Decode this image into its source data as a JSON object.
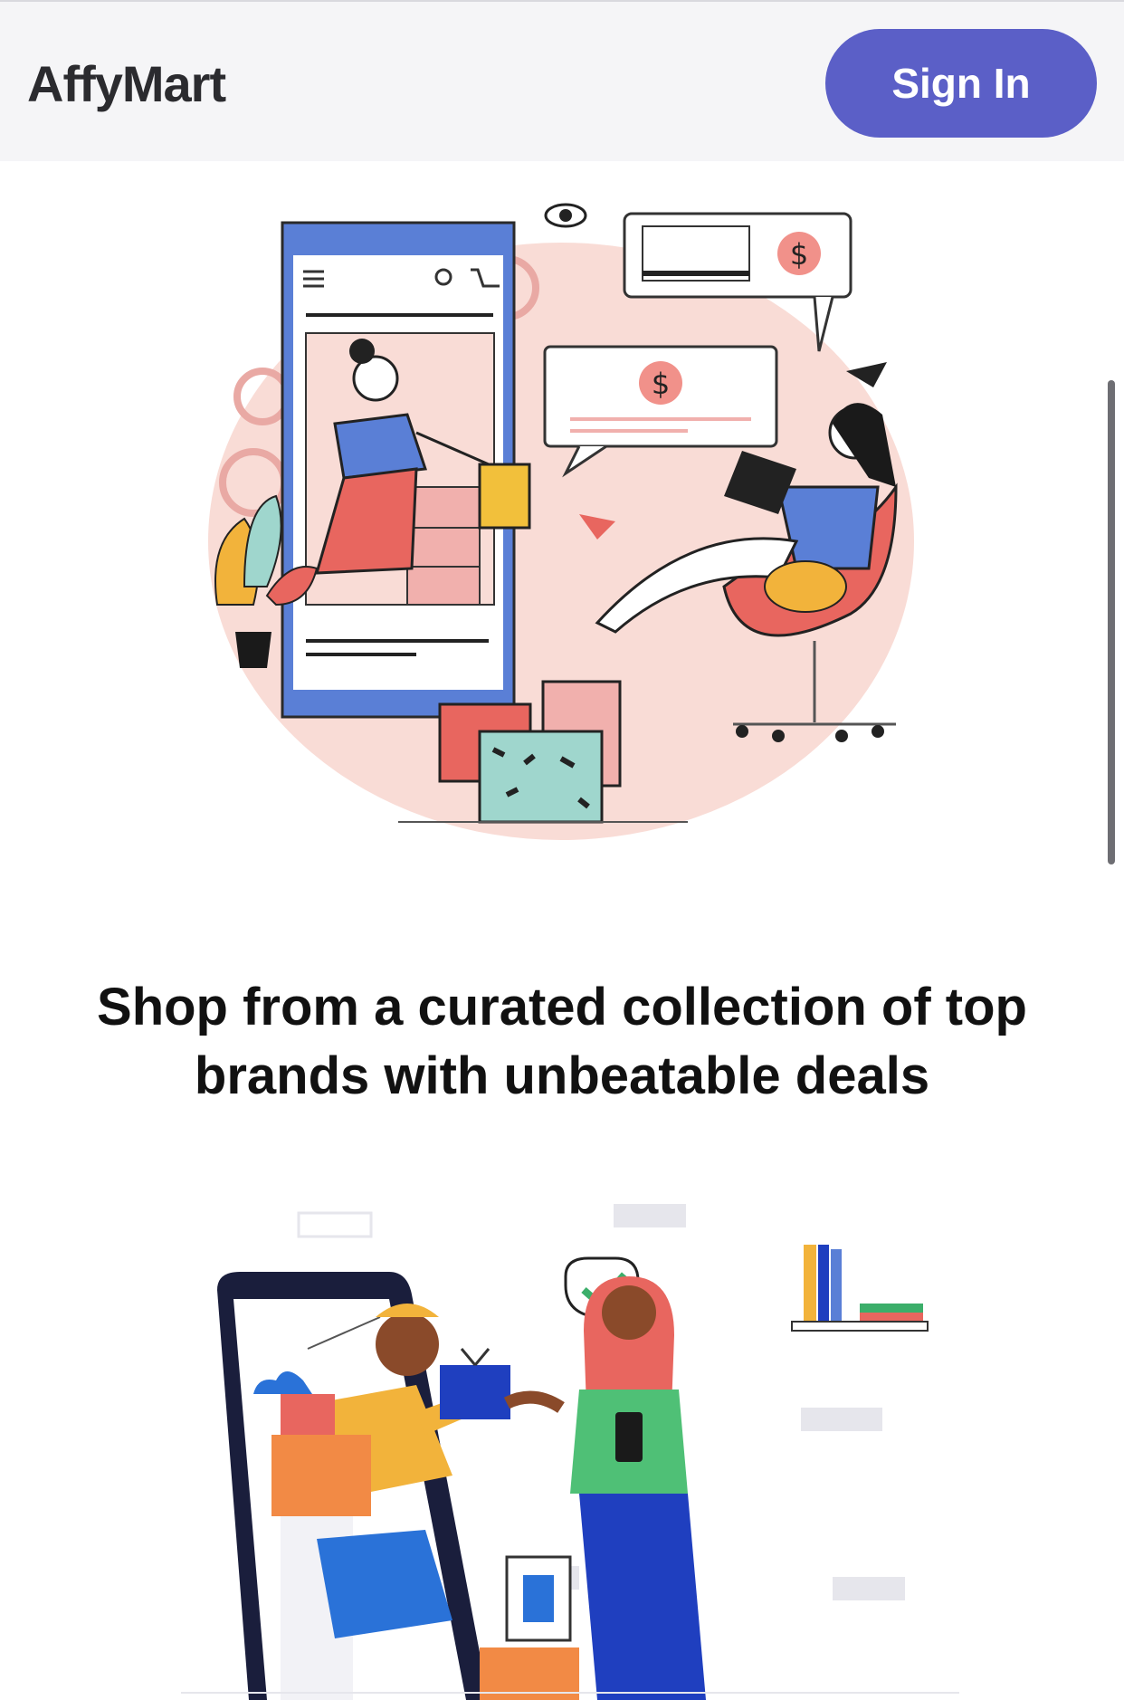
{
  "header": {
    "brand": "AffyMart",
    "signin_label": "Sign In"
  },
  "hero": {
    "tagline": "Shop from a curated collection of top brands with unbeatable deals"
  },
  "colors": {
    "accent": "#5b5fc7",
    "header_bg": "#f5f5f7",
    "illustration_blob": "#f9dcd6",
    "phone_blue": "#5a7fd6"
  },
  "illustrations": [
    {
      "name": "online-shopping-illustration"
    },
    {
      "name": "delivery-handoff-illustration"
    }
  ]
}
